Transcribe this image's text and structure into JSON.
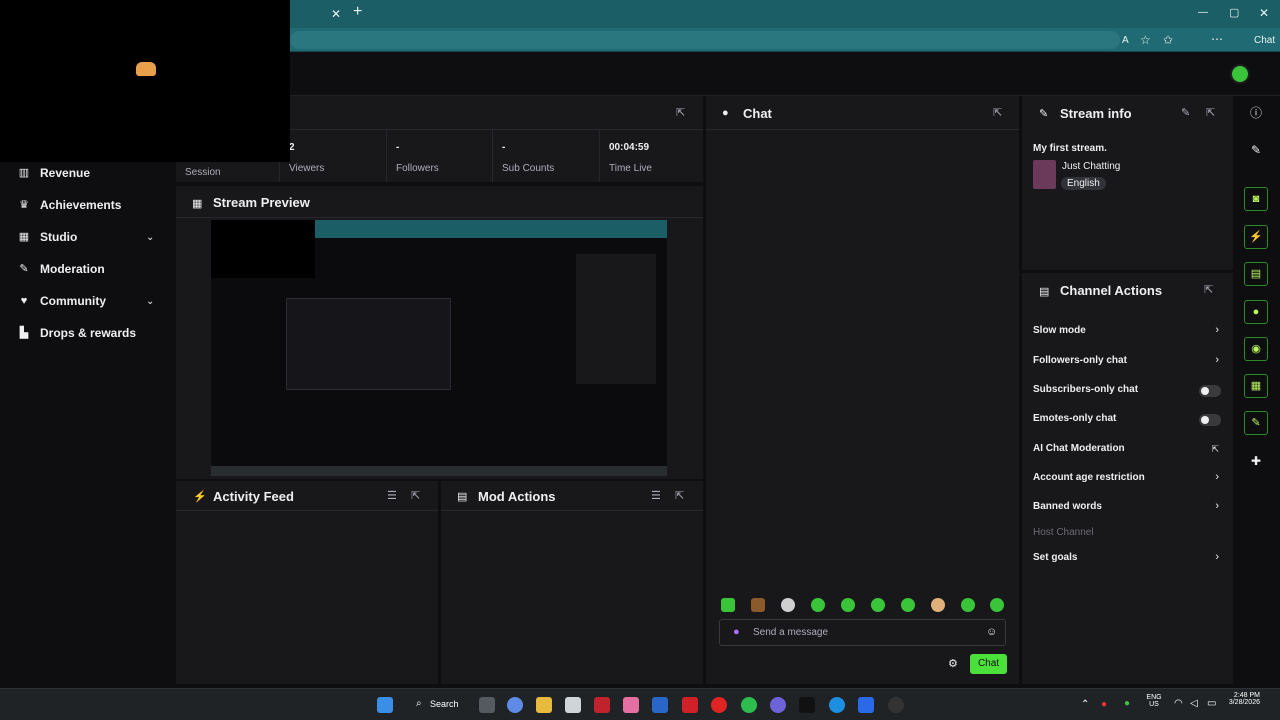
{
  "browser": {
    "close_tab": "✕",
    "new_tab": "+",
    "chat_label": "Chat",
    "win_min": "—",
    "win_max": "▢",
    "win_close": "✕"
  },
  "sidebar": {
    "items": [
      {
        "label": "Revenue",
        "icon": "bar-chart-icon"
      },
      {
        "label": "Achievements",
        "icon": "trophy-icon"
      },
      {
        "label": "Studio",
        "icon": "film-icon",
        "expandable": true
      },
      {
        "label": "Moderation",
        "icon": "wrench-icon"
      },
      {
        "label": "Community",
        "icon": "users-icon",
        "expandable": true
      },
      {
        "label": "Drops & rewards",
        "icon": "gift-icon"
      }
    ]
  },
  "stats": {
    "session_label": "Session",
    "viewers": {
      "value": "2",
      "label": "Viewers"
    },
    "followers": {
      "value": "-",
      "label": "Followers"
    },
    "sub_counts": {
      "value": "-",
      "label": "Sub Counts"
    },
    "time_live": {
      "value": "00:04:59",
      "label": "Time Live"
    }
  },
  "stream_preview": {
    "title": "Stream Preview"
  },
  "activity_feed": {
    "title": "Activity Feed"
  },
  "mod_actions": {
    "title": "Mod Actions"
  },
  "chat": {
    "title": "Chat",
    "placeholder": "Send a message",
    "send_label": "Chat"
  },
  "stream_info": {
    "title": "Stream info",
    "stream_title": "My first stream.",
    "category": "Just Chatting",
    "language": "English"
  },
  "channel_actions": {
    "title": "Channel Actions",
    "items": [
      {
        "label": "Slow mode",
        "control": "chevron"
      },
      {
        "label": "Followers-only chat",
        "control": "chevron"
      },
      {
        "label": "Subscribers-only chat",
        "control": "toggle",
        "state": "off"
      },
      {
        "label": "Emotes-only chat",
        "control": "toggle",
        "state": "off"
      },
      {
        "label": "AI Chat Moderation",
        "control": "external"
      },
      {
        "label": "Account age restriction",
        "control": "chevron"
      },
      {
        "label": "Banned words",
        "control": "chevron"
      },
      {
        "label": "Host Channel",
        "control": "none",
        "disabled": true
      },
      {
        "label": "Set goals",
        "control": "chevron"
      }
    ]
  },
  "taskbar": {
    "search_label": "Search",
    "lang": "ENG",
    "region": "US",
    "time": "2:48 PM",
    "date": "3/28/2026"
  },
  "colors": {
    "accent": "#4ce03a",
    "browser_chrome": "#1b5e66",
    "panel_bg": "#18181b",
    "app_bg": "#0e0e10"
  }
}
